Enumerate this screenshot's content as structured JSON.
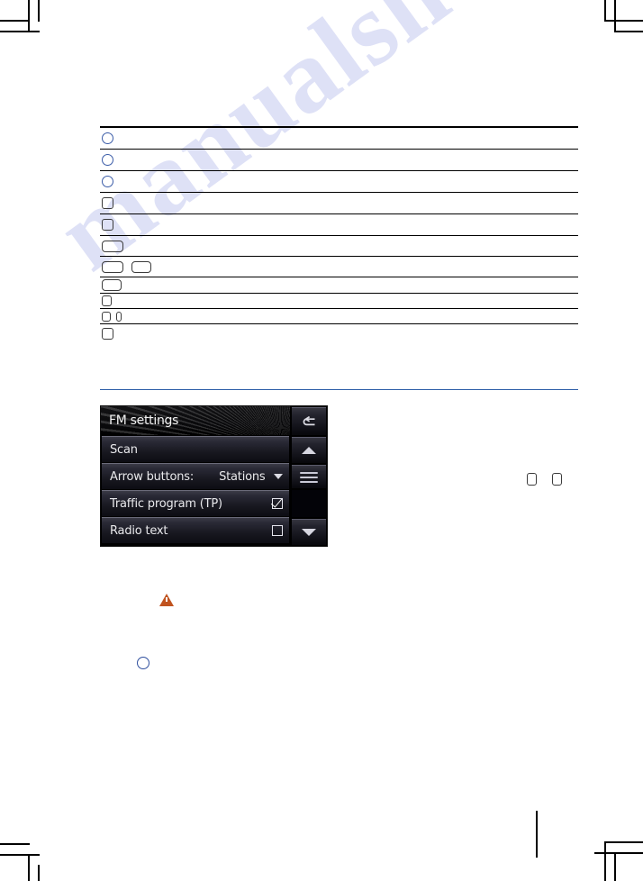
{
  "page": {
    "background_color": "#ffffff",
    "watermark_text": "manualslive.com",
    "watermark_color": "#d9dcf5",
    "rule_color_blue": "#2f5fa8",
    "rule_color_black": "#000000"
  },
  "key_table": {
    "rows": [
      {
        "icon": "circle-outline-blue",
        "label": ""
      },
      {
        "icon": "circle-outline-blue",
        "label": ""
      },
      {
        "icon": "circle-outline-blue",
        "label": ""
      },
      {
        "icon": "rounded-square-outline",
        "label": ""
      },
      {
        "icon": "rounded-square-outline",
        "label": ""
      },
      {
        "icon": "rounded-wide-button-outline",
        "label": ""
      },
      {
        "icon": "rounded-wide-button-pair",
        "label": ""
      },
      {
        "icon": "rounded-wide-button-outline",
        "label": ""
      },
      {
        "icon": "rounded-square-small",
        "label": ""
      },
      {
        "icon": "rounded-square-narrow-pair",
        "label": ""
      },
      {
        "icon": "rounded-square-outline",
        "label": ""
      }
    ]
  },
  "device_screen": {
    "title": "FM settings",
    "items": [
      {
        "label": "Scan",
        "value": "",
        "control": "none"
      },
      {
        "label": "Arrow buttons:",
        "value": "Stations",
        "control": "dropdown"
      },
      {
        "label": "Traffic program (TP)",
        "value": "",
        "control": "checkbox-checked"
      },
      {
        "label": "Radio text",
        "value": "",
        "control": "checkbox-unchecked"
      }
    ],
    "side_buttons": [
      {
        "name": "back",
        "icon": "return-arrow-icon"
      },
      {
        "name": "scroll-up",
        "icon": "chevron-up-icon"
      },
      {
        "name": "scroll-thumb",
        "icon": "scroll-thumb-icon"
      },
      {
        "name": "scroll-down",
        "icon": "chevron-down-icon"
      }
    ]
  },
  "side_placeholders": [
    {
      "icon": "rounded-square-outline"
    },
    {
      "icon": "rounded-square-outline"
    }
  ],
  "notes": {
    "warning": {
      "icon": "warning-triangle-icon",
      "color": "#c0531f",
      "text": ""
    },
    "bullet": {
      "icon": "circle-outline-blue",
      "color": "#2f4f9e",
      "text": ""
    }
  }
}
